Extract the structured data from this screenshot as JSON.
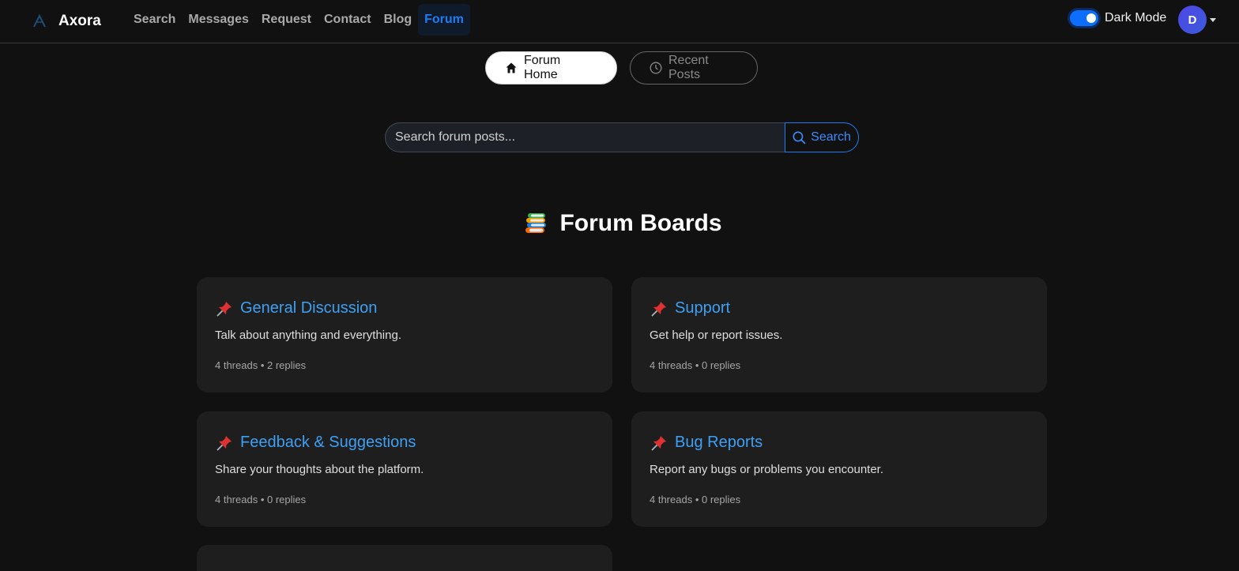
{
  "brand": {
    "name": "Axora"
  },
  "nav": {
    "links": [
      "Search",
      "Messages",
      "Request",
      "Contact",
      "Blog",
      "Forum"
    ],
    "active": "Forum"
  },
  "dark_mode": {
    "label": "Dark Mode",
    "enabled": true
  },
  "user": {
    "initial": "D"
  },
  "tabs": {
    "home": "Forum Home",
    "recent": "Recent Posts"
  },
  "search": {
    "placeholder": "Search forum posts...",
    "button": "Search"
  },
  "heading": "Forum Boards",
  "boards": [
    {
      "name": "General Discussion",
      "description": "Talk about anything and everything.",
      "stats": "4 threads • 2 replies"
    },
    {
      "name": "Support",
      "description": "Get help or report issues.",
      "stats": "4 threads • 0 replies"
    },
    {
      "name": "Feedback & Suggestions",
      "description": "Share your thoughts about the platform.",
      "stats": "4 threads • 0 replies"
    },
    {
      "name": "Bug Reports",
      "description": "Report any bugs or problems you encounter.",
      "stats": "4 threads • 0 replies"
    }
  ],
  "colors": {
    "accent": "#1e7cf2",
    "link": "#3ea0f5",
    "background": "#111111",
    "card": "#1e1e1e"
  }
}
